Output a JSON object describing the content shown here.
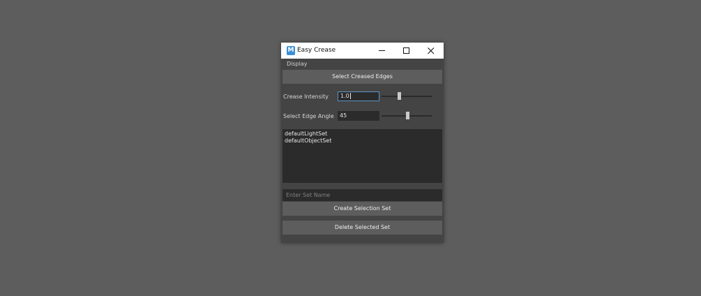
{
  "window": {
    "title": "Easy Crease",
    "icon_label": "M",
    "icon_name": "maya-app-icon"
  },
  "menu": {
    "display_label": "Display"
  },
  "buttons": {
    "select_creased_edges": "Select Creased Edges",
    "create_selection_set": "Create Selection Set",
    "delete_selected_set": "Delete Selected Set"
  },
  "crease_intensity": {
    "label": "Crease Intensity",
    "value": "1.0",
    "slider_fraction": 0.35
  },
  "edge_angle": {
    "label": "Select Edge Angle",
    "value": "45",
    "slider_fraction": 0.52
  },
  "sets": {
    "items": [
      "defaultLightSet",
      "defaultObjectSet"
    ]
  },
  "set_name": {
    "placeholder": "Enter Set Name",
    "value": ""
  },
  "colors": {
    "desktop": "#5d5d5d",
    "window_bg": "#444444",
    "field_bg": "#2b2b2b",
    "button_bg": "#5d5d5d",
    "focus_border": "#5b93c4"
  }
}
